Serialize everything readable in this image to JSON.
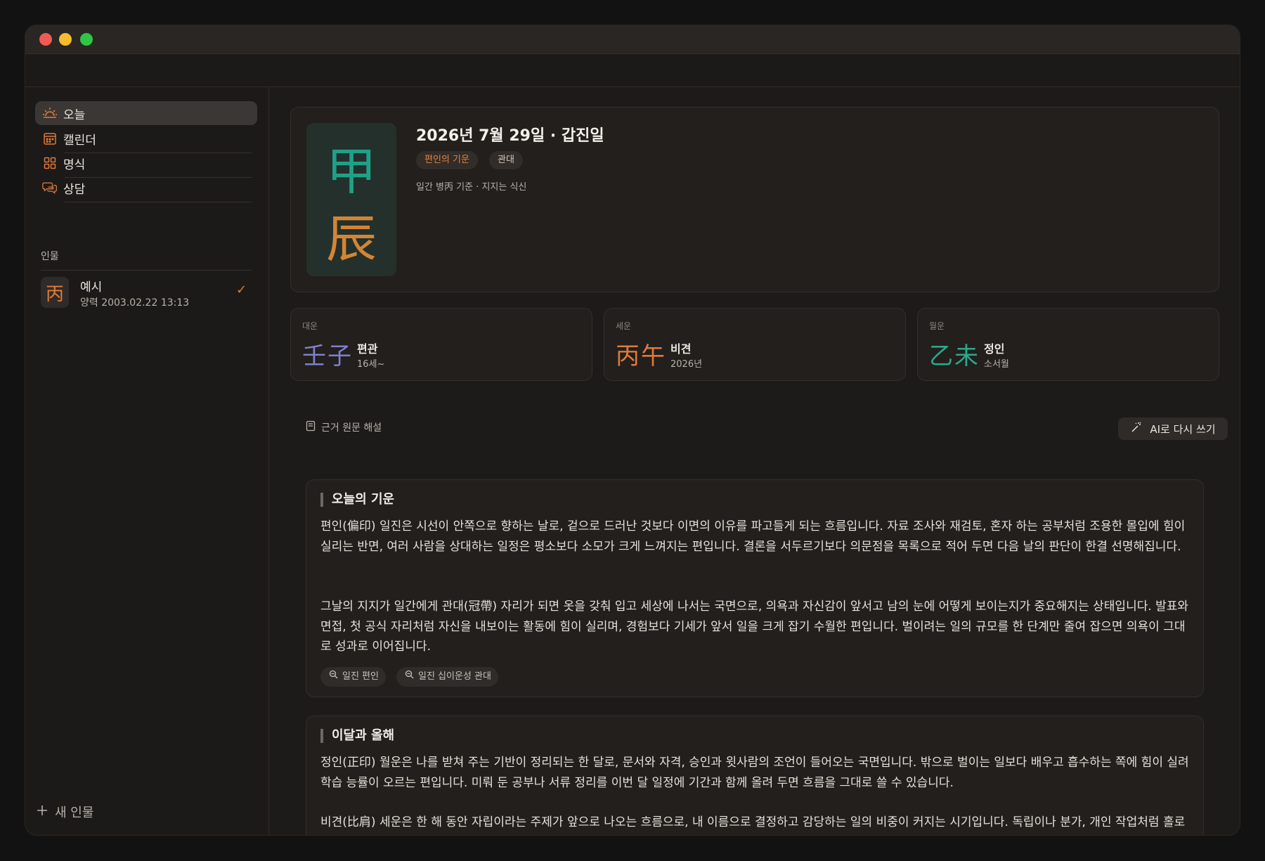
{
  "sidebar": {
    "nav": [
      {
        "label": "오늘",
        "icon": "sun-icon"
      },
      {
        "label": "캘린더",
        "icon": "calendar-icon"
      },
      {
        "label": "명식",
        "icon": "grid-icon"
      },
      {
        "label": "상담",
        "icon": "chat-icon"
      }
    ],
    "section_label": "인물",
    "person": {
      "badge": "丙",
      "name": "예시",
      "date": "양력 2003.02.22 13:13"
    },
    "new_person_label": "새 인물"
  },
  "hero": {
    "stem": "甲",
    "branch": "辰",
    "title": "2026년 7월 29일 · 갑진일",
    "tags": [
      "편인의 기운",
      "관대"
    ],
    "subtitle": "일간 병丙 기준 · 지지는 식신"
  },
  "luck": [
    {
      "label": "대운",
      "hanja": "壬子",
      "name": "편관",
      "sub": "16세~",
      "color": "#7f7fd0"
    },
    {
      "label": "세운",
      "hanja": "丙午",
      "name": "비견",
      "sub": "2026년",
      "color": "#e07a3a"
    },
    {
      "label": "월운",
      "hanja": "乙未",
      "name": "정인",
      "sub": "소서월",
      "color": "#2aa88c"
    }
  ],
  "sources_label": "근거 원문 해설",
  "ai_button_label": "AI로 다시 쓰기",
  "sections": [
    {
      "title": "오늘의 기운",
      "paragraphs": [
        "편인(偏印) 일진은 시선이 안쪽으로 향하는 날로, 겉으로 드러난 것보다 이면의 이유를 파고들게 되는 흐름입니다. 자료 조사와 재검토, 혼자 하는 공부처럼 조용한 몰입에 힘이 실리는 반면, 여러 사람을 상대하는 일정은 평소보다 소모가 크게 느껴지는 편입니다. 결론을 서두르기보다 의문점을 목록으로 적어 두면 다음 날의 판단이 한결 선명해집니다.",
        "그날의 지지가 일간에게 관대(冠帶) 자리가 되면 옷을 갖춰 입고 세상에 나서는 국면으로, 의욕과 자신감이 앞서고 남의 눈에 어떻게 보이는지가 중요해지는 상태입니다. 발표와 면접, 첫 공식 자리처럼 자신을 내보이는 활동에 힘이 실리며, 경험보다 기세가 앞서 일을 크게 잡기 수월한 편입니다. 벌이려는 일의 규모를 한 단계만 줄여 잡으면 의욕이 그대로 성과로 이어집니다."
      ],
      "chips": [
        "일진 편인",
        "일진 십이운성 관대"
      ]
    },
    {
      "title": "이달과 올해",
      "paragraphs": [
        "정인(正印) 월운은 나를 받쳐 주는 기반이 정리되는 한 달로, 문서와 자격, 승인과 윗사람의 조언이 들어오는 국면입니다. 밖으로 벌이는 일보다 배우고 흡수하는 쪽에 힘이 실려 학습 능률이 오르는 편입니다. 미뤄 둔 공부나 서류 정리를 이번 달 일정에 기간과 함께 올려 두면 흐름을 그대로 쓸 수 있습니다.",
        "비견(比肩) 세운은 한 해 동안 자립이라는 주제가 앞으로 나오는 흐름으로, 내 이름으로 결정하고 감당하는 일의 비중이 커지는 시기입니다. 독립이나 분가, 개인 작업처럼 홀로 서는 형태의 변화가 논의되기 수월하고, 동료나 경쟁자와 몫을 나누는 장면도 함께 늘어나는 편입니다. 한 해를 시작하며 혼자 감당할 일과 함께 갈 일의 목록을 나눠 두면 일 년의 방향이 흔들리지 않습니다."
      ]
    }
  ]
}
